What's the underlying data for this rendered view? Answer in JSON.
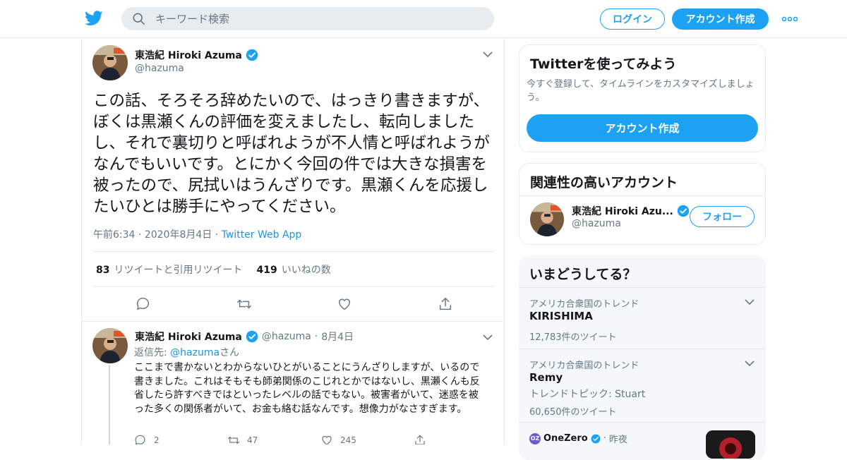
{
  "header": {
    "search_placeholder": "キーワード検索",
    "login_label": "ログイン",
    "signup_label": "アカウント作成"
  },
  "main_tweet": {
    "display_name": "東浩紀 Hiroki Azuma",
    "handle": "@hazuma",
    "text": "この話、そろそろ辞めたいので、はっきり書きますが、ぼくは黒瀬くんの評価を変えましたし、転向しましたし、それで裏切りと呼ばれようが不人情と呼ばれようがなんでもいいです。とにかく今回の件では大きな損害を被ったので、尻拭いはうんざりです。黒瀬くんを応援したいひとは勝手にやってください。",
    "time": "午前6:34",
    "date": "2020年8月4日",
    "source": "Twitter Web App",
    "retweets_count": "83",
    "retweets_label": "リツイートと引用リツイート",
    "likes_count": "419",
    "likes_label": "いいねの数"
  },
  "reply_tweet": {
    "display_name": "東浩紀 Hiroki Azuma",
    "handle": "@hazuma",
    "date": "8月4日",
    "reply_prefix": "返信先: ",
    "reply_handle": "@hazuma",
    "reply_suffix": "さん",
    "text": "ここまで書かないとわからないひとがいることにうんざりしますが、いるので書きました。これはそもそも師弟関係のこじれとかではないし、黒瀬くんも反省したら許すべきではといったレベルの話でもない。被害者がいて、迷惑を被った多くの関係者がいて、お金も絡む話なんです。想像力がなさすぎます。",
    "reply_count": "2",
    "retweet_count": "47",
    "like_count": "245"
  },
  "sidebar": {
    "try_title": "Twitterを使ってみよう",
    "try_desc": "今すぐ登録して、タイムラインをカスタマイズしましょう。",
    "try_button": "アカウント作成",
    "related_title": "関連性の高いアカウント",
    "related_name": "東浩紀 Hiroki Azu...",
    "related_handle": "@hazuma",
    "follow_label": "フォロー",
    "trends_title": "いまどうしてる？",
    "trends": [
      {
        "context": "アメリカ合衆国のトレンド",
        "name": "KIRISHIMA",
        "count": "12,783件のツイート"
      },
      {
        "context": "アメリカ合衆国のトレンド",
        "name": "Remy",
        "topic": "トレンドトピック: Stuart",
        "count": "60,650件のツイート"
      }
    ],
    "news_source": "OneZero",
    "news_time": "昨夜"
  },
  "colors": {
    "accent": "#1da1f2",
    "link": "#1b95e0",
    "muted": "#657786"
  }
}
